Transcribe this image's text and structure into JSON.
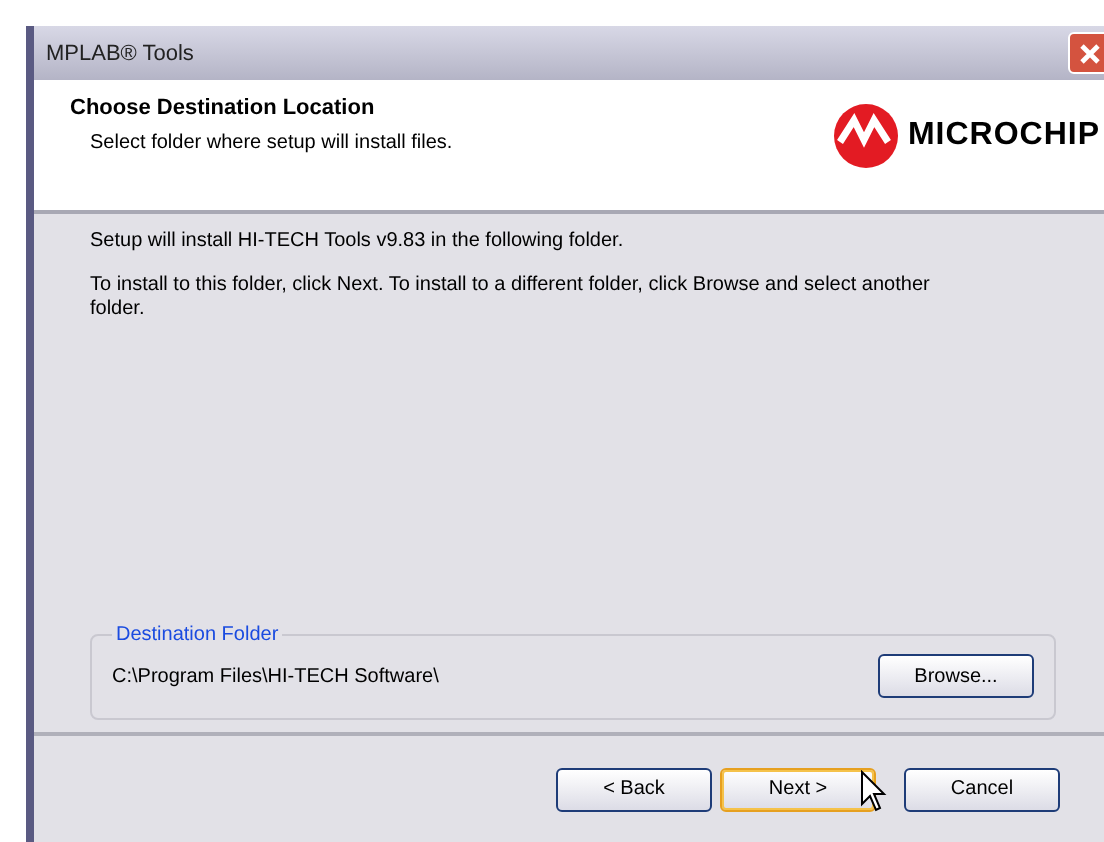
{
  "window": {
    "title": "MPLAB® Tools"
  },
  "header": {
    "title": "Choose Destination Location",
    "subtitle": "Select folder where setup will install files.",
    "logo_text": "MICROCHIP"
  },
  "body": {
    "paragraphs": [
      "Setup will install HI-TECH Tools v9.83 in the following folder.",
      "To install to this folder, click Next. To install to a different folder, click Browse and select another folder."
    ]
  },
  "destination": {
    "legend": "Destination Folder",
    "path": "C:\\Program Files\\HI-TECH Software\\",
    "browse": "Browse..."
  },
  "buttons": [
    {
      "label": "< Back",
      "default": false
    },
    {
      "label": "Next >",
      "default": true
    },
    {
      "label": "Cancel",
      "default": false
    }
  ]
}
